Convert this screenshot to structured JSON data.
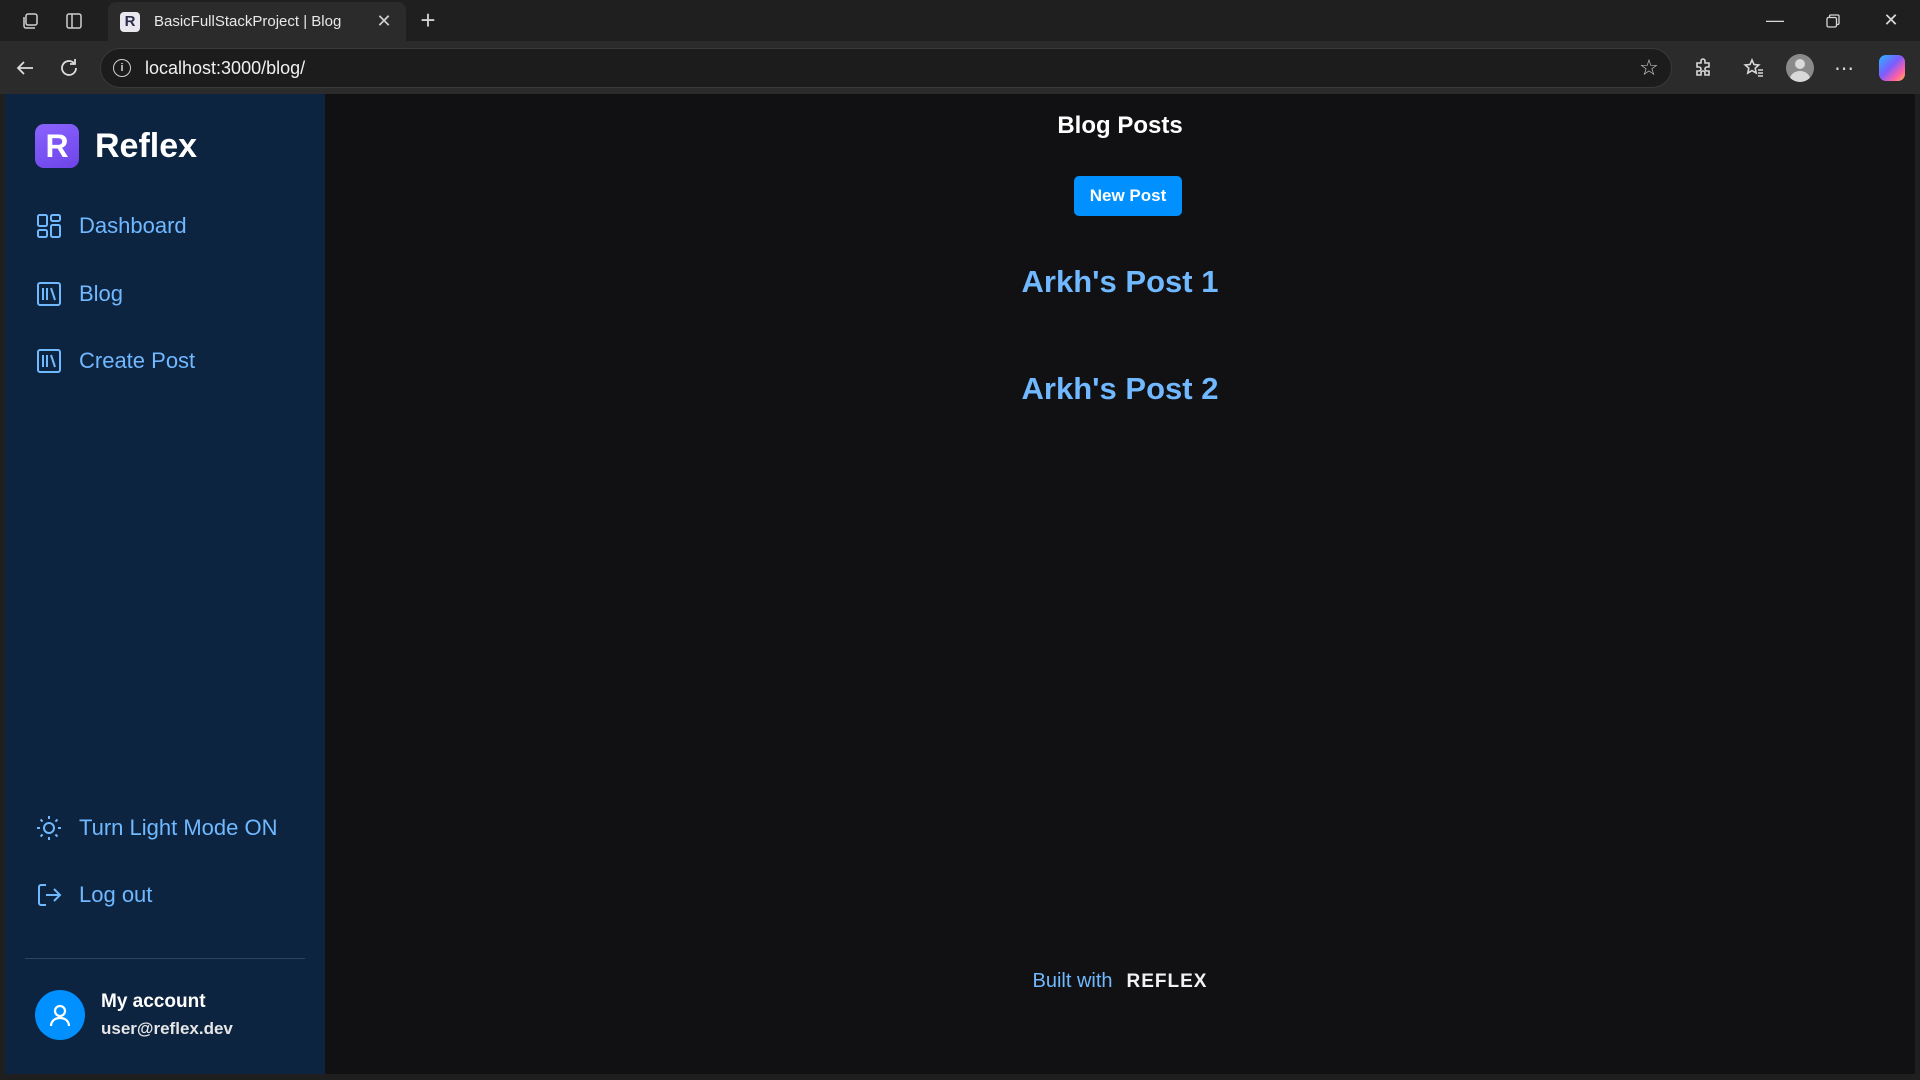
{
  "browser": {
    "tab_title": "BasicFullStackProject | Blog",
    "tab_favicon_letter": "R",
    "url": "localhost:3000/blog/"
  },
  "sidebar": {
    "brand": "Reflex",
    "brand_logo_letter": "R",
    "nav": [
      {
        "label": "Dashboard",
        "icon": "dashboard-icon"
      },
      {
        "label": "Blog",
        "icon": "library-icon"
      },
      {
        "label": "Create Post",
        "icon": "library-icon"
      }
    ],
    "bottom": [
      {
        "label": "Turn Light Mode ON",
        "icon": "sun-icon"
      },
      {
        "label": "Log out",
        "icon": "logout-icon"
      }
    ],
    "account": {
      "name": "My account",
      "email": "user@reflex.dev"
    }
  },
  "main": {
    "title": "Blog Posts",
    "new_post_label": "New Post",
    "posts": [
      "Arkh's Post 1",
      "Arkh's Post 2"
    ],
    "footer_text": "Built with",
    "footer_logo": "REFLEX"
  },
  "colors": {
    "accent": "#0090ff",
    "link": "#70b8ff",
    "sidebar_bg": "#0d2440",
    "page_bg": "#111113",
    "brand_purple": "#7a52f4"
  }
}
